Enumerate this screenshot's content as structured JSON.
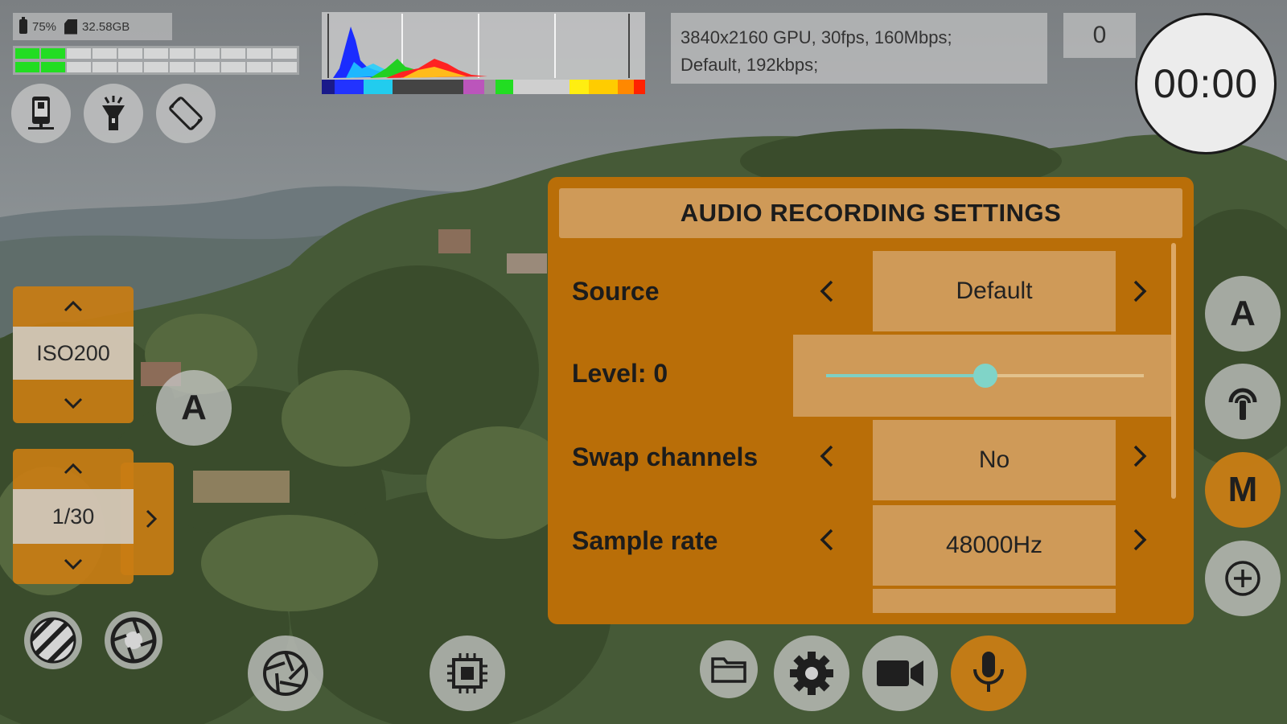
{
  "status": {
    "battery": "75%",
    "storage": "32.58GB",
    "audio_meter_level": 0.18
  },
  "info": {
    "line1": "3840x2160 GPU, 30fps, 160Mbps;",
    "line2": "Default, 192kbps;"
  },
  "counter": "0",
  "timer": "00:00",
  "left_controls": {
    "iso_value": "ISO200",
    "iso_mode_label": "A",
    "shutter_value": "1/30"
  },
  "right_controls": {
    "auto_label": "A",
    "manual_label": "M"
  },
  "dialog": {
    "title": "AUDIO RECORDING SETTINGS",
    "source_label": "Source",
    "source_value": "Default",
    "level_label": "Level: 0",
    "level_fraction": 0.5,
    "swap_label": "Swap channels",
    "swap_value": "No",
    "sample_label": "Sample rate",
    "sample_value": "48000Hz"
  },
  "icons": {
    "top_row": [
      "phone-settings-icon",
      "flashlight-icon",
      "rotate-lock-icon"
    ],
    "bottom_row": [
      "zebra-icon",
      "lens-icon",
      "aperture-icon",
      "processor-icon",
      "folder-icon",
      "settings-gear-icon",
      "video-camera-icon",
      "microphone-icon"
    ],
    "right_column": [
      "auto-exposure-icon",
      "stabilizer-icon",
      "manual-mode-icon",
      "zoom-in-icon"
    ]
  },
  "colors": {
    "accent_orange": "#c97d14",
    "dialog_orange": "#b96e08",
    "field_tan": "#cf9a58",
    "slider_teal": "#80d4c8",
    "meter_green": "#22dd22"
  }
}
